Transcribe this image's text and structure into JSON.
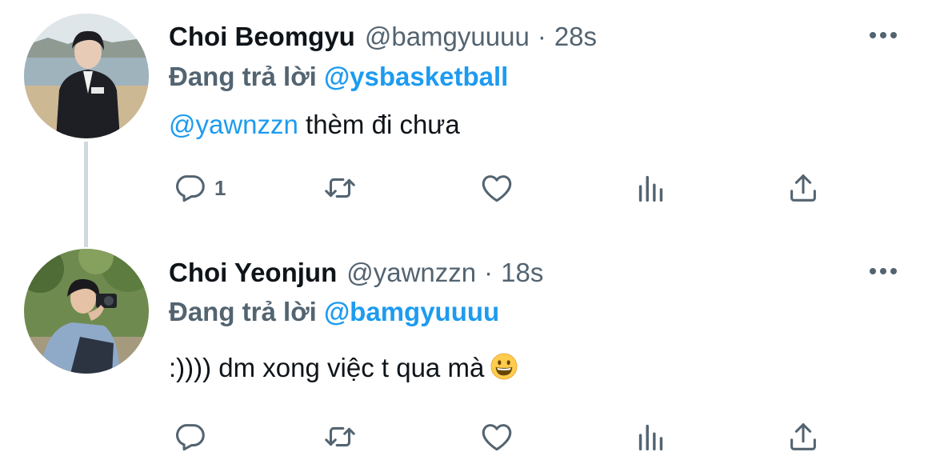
{
  "tweets": [
    {
      "display_name": "Choi Beomgyu",
      "handle": "@bamgyuuuu",
      "separator": "·",
      "time": "28s",
      "replying_prefix": "Đang trả lời",
      "replying_to": "@ysbasketball",
      "body_mention": "@yawnzzn",
      "body_text": " thèm đi chưa",
      "reply_count": "1",
      "avatar_icon": "avatar-photo-beach"
    },
    {
      "display_name": "Choi Yeonjun",
      "handle": "@yawnzzn",
      "separator": "·",
      "time": "18s",
      "replying_prefix": "Đang trả lời",
      "replying_to": "@bamgyuuuu",
      "body_mention": "",
      "body_text": ":)))) dm xong việc t qua mà",
      "body_emoji": "grinning-face-emoji",
      "reply_count": "",
      "avatar_icon": "avatar-photo-park"
    }
  ],
  "icons": {
    "reply": "reply-icon",
    "retweet": "retweet-icon",
    "like": "heart-icon",
    "views": "views-icon",
    "share": "share-icon",
    "more": "more-options-icon"
  },
  "colors": {
    "text": "#0f1419",
    "secondary": "#536471",
    "link": "#1d9bf0",
    "thread_line": "#cfd9de",
    "background": "#ffffff"
  }
}
